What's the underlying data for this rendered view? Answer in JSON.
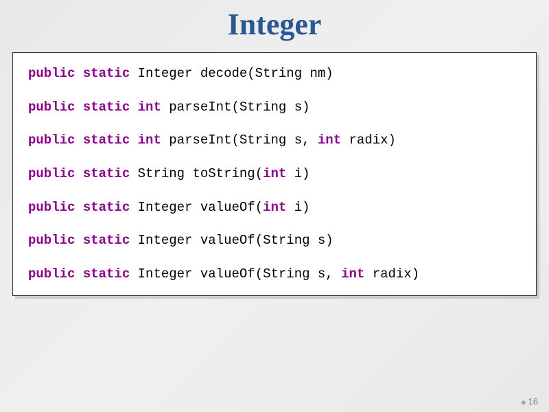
{
  "title": "Integer",
  "methods": [
    {
      "prefix": "public static",
      "ret_kw": "",
      "ret": "Integer ",
      "name": "decode",
      "sig_pre": "(String nm)",
      "kw2": "",
      "sig_post": ""
    },
    {
      "prefix": "public static",
      "ret_kw": "int",
      "ret": " ",
      "name": "parseInt",
      "sig_pre": "(String s)",
      "kw2": "",
      "sig_post": ""
    },
    {
      "prefix": "public static",
      "ret_kw": "int",
      "ret": " ",
      "name": "parseInt",
      "sig_pre": "(String s, ",
      "kw2": "int",
      "sig_post": " radix)"
    },
    {
      "prefix": "public static",
      "ret_kw": "",
      "ret": "String ",
      "name": "toString",
      "sig_pre": "(",
      "kw2": "int",
      "sig_post": " i)"
    },
    {
      "prefix": "public static",
      "ret_kw": "",
      "ret": "Integer ",
      "name": "valueOf",
      "sig_pre": "(",
      "kw2": "int",
      "sig_post": " i)"
    },
    {
      "prefix": "public static",
      "ret_kw": "",
      "ret": "Integer ",
      "name": "valueOf",
      "sig_pre": "(String s)",
      "kw2": "",
      "sig_post": ""
    },
    {
      "prefix": "public static",
      "ret_kw": "",
      "ret": "Integer ",
      "name": "valueOf",
      "sig_pre": "(String s, ",
      "kw2": "int",
      "sig_post": " radix)"
    }
  ],
  "pageNumber": "16"
}
